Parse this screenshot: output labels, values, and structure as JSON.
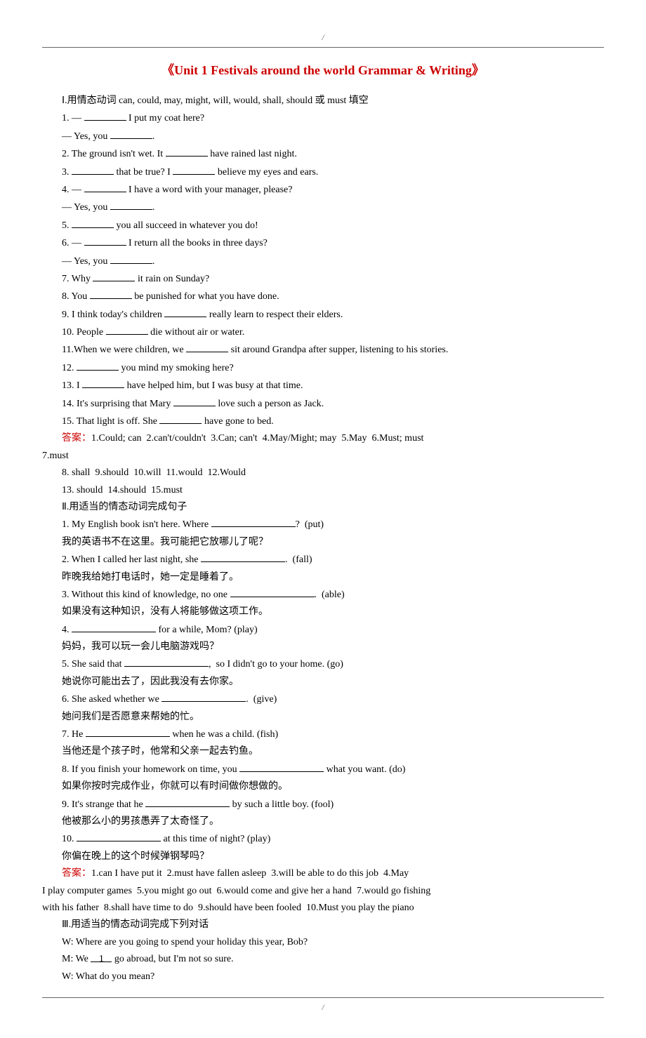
{
  "slash": "/",
  "title": "《Unit 1 Festivals around the world Grammar & Writing》",
  "section1": {
    "heading": "Ⅰ.用情态动词 can, could, may, might, will, would, shall, should 或 must 填空",
    "items": {
      "q1a": "1. — ",
      "q1b": " I put my coat here?",
      "q1c": "— Yes, you ",
      "q1d": ".",
      "q2a": "2. The ground isn't wet. It ",
      "q2b": " have rained last night.",
      "q3a": "3. ",
      "q3b": " that be true? I ",
      "q3c": " believe my eyes and ears.",
      "q4a": "4. — ",
      "q4b": " I have a word with your manager, please?",
      "q4c": "— Yes, you ",
      "q4d": ".",
      "q5a": "5. ",
      "q5b": " you all succeed in whatever you do!",
      "q6a": "6. — ",
      "q6b": " I return all the books in three days?",
      "q6c": "— Yes, you ",
      "q6d": ".",
      "q7a": "7. Why ",
      "q7b": " it rain on Sunday?",
      "q8a": "8. You ",
      "q8b": " be punished for what you have done.",
      "q9a": "9. I think today's children ",
      "q9b": " really learn to respect their elders.",
      "q10a": "10. People ",
      "q10b": " die without air or water.",
      "q11a": "11.When we were children, we ",
      "q11b": " sit around Grandpa after supper, listening to his stories.",
      "q12a": "12. ",
      "q12b": " you mind my smoking here?",
      "q13a": "13. I ",
      "q13b": " have helped him, but I was busy at that time.",
      "q14a": "14. It's surprising that Mary ",
      "q14b": " love such a person as Jack.",
      "q15a": "15. That light is off. She ",
      "q15b": " have gone to bed."
    },
    "answer_label": "答案：",
    "answer_line1": "1.Could; can  2.can't/couldn't  3.Can; can't  4.May/Might; may  5.May  6.Must; must",
    "answer_line1b": "7.must",
    "answer_line2": "8. shall  9.should  10.will  11.would  12.Would",
    "answer_line3": "13. should  14.should  15.must"
  },
  "section2": {
    "heading": "Ⅱ.用适当的情态动词完成句子",
    "items": {
      "q1a": "1. My English book isn't here. Where ",
      "q1b": "?  (put)",
      "q1c": "我的英语书不在这里。我可能把它放哪儿了呢？",
      "q2a": "2. When I called her last night, she ",
      "q2b": ".  (fall)",
      "q2c": "昨晚我给她打电话时，她一定是睡着了。",
      "q3a": "3. Without this kind of knowledge, no one ",
      "q3b": ".  (able)",
      "q3c": "如果没有这种知识，没有人将能够做这项工作。",
      "q4a": "4. ",
      "q4b": " for a while, Mom? (play)",
      "q4c": "妈妈，我可以玩一会儿电脑游戏吗？",
      "q5a": "5. She said that ",
      "q5b": ",  so I didn't go to your home. (go)",
      "q5c": "她说你可能出去了，因此我没有去你家。",
      "q6a": "6. She asked whether we ",
      "q6b": ".  (give)",
      "q6c": "她问我们是否愿意来帮她的忙。",
      "q7a": "7. He ",
      "q7b": " when he was a child. (fish)",
      "q7c": "当他还是个孩子时，他常和父亲一起去钓鱼。",
      "q8a": "8. If you finish your homework on time, you ",
      "q8b": " what you want. (do)",
      "q8c": "如果你按时完成作业，你就可以有时间做你想做的。",
      "q9a": "9. It's strange that he ",
      "q9b": " by such a little boy. (fool)",
      "q9c": "他被那么小的男孩愚弄了太奇怪了。",
      "q10a": "10. ",
      "q10b": " at this time of night? (play)",
      "q10c": "你偏在晚上的这个时候弹钢琴吗？"
    },
    "answer_label": "答案：",
    "answer_line1": "1.can I have put it  2.must have fallen asleep  3.will be able to do this job  4.May",
    "answer_line2": "I play computer games  5.you might go out  6.would come and give her a hand  7.would go fishing",
    "answer_line3": "with his father  8.shall have time to do  9.should have been fooled  10.Must you play the piano"
  },
  "section3": {
    "heading": "Ⅲ.用适当的情态动词完成下列对话",
    "w1": "W: Where are you going to spend your holiday this year, Bob?",
    "m1a": "M: We ",
    "m1b": " go abroad, but I'm not so sure.",
    "w2": "W: What do you mean?",
    "blank1": "1"
  }
}
